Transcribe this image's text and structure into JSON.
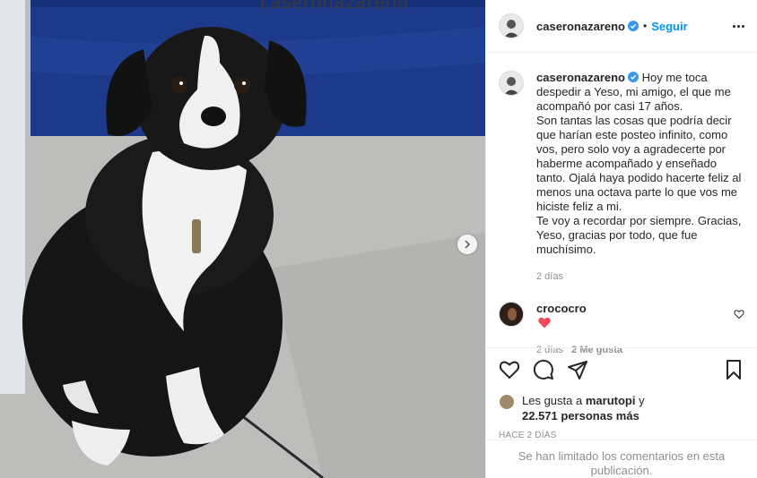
{
  "media": {
    "overlay_text": "caseronazareno",
    "next_icon": "chevron-right-icon"
  },
  "header": {
    "username": "caseronazareno",
    "separator": "•",
    "follow_label": "Seguir",
    "more_icon": "more-horizontal-icon"
  },
  "caption": {
    "username": "caseronazareno",
    "text": "Hoy me toca despedir a Yeso, mi amigo, el que me acompañó por casi 17 años.\nSon tantas las cosas que podría decir que harían este posteo infinito, como vos, pero solo voy a agradecerte por haberme acompañado y enseñado tanto. Ojalá haya podido hacerte feliz al menos una octava parte lo que vos me hiciste feliz a mi.\nTe voy a recordar por siempre. Gracias, Yeso, gracias por todo, que fue muchísimo.",
    "time": "2 días"
  },
  "comment": {
    "username": "crococro",
    "time": "2 días",
    "likes": "2 Me gusta"
  },
  "likes": {
    "prefix": "Les gusta a",
    "liker": "marutopi",
    "connector": "y",
    "others": "22.571 personas más"
  },
  "post_date": "HACE 2 DÍAS",
  "comments_limited": "Se han limitado los comentarios en esta publicación.",
  "colors": {
    "link_blue": "#0095f6",
    "muted": "#8e8e8e",
    "heart_red": "#ed4956"
  }
}
